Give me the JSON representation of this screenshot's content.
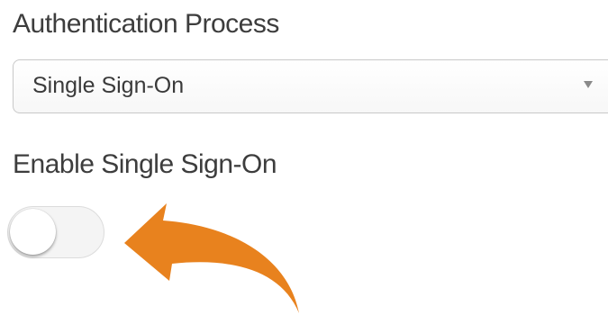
{
  "auth": {
    "label": "Authentication Process",
    "selected": "Single Sign-On"
  },
  "sso": {
    "label": "Enable Single Sign-On",
    "enabled": false
  },
  "colors": {
    "arrow": "#e8821e",
    "border": "#c8c8c8",
    "toggle_track": "#f4f4f4"
  },
  "icons": {
    "select_caret": "caret-down-icon",
    "pointer_arrow": "curved-arrow-icon"
  }
}
